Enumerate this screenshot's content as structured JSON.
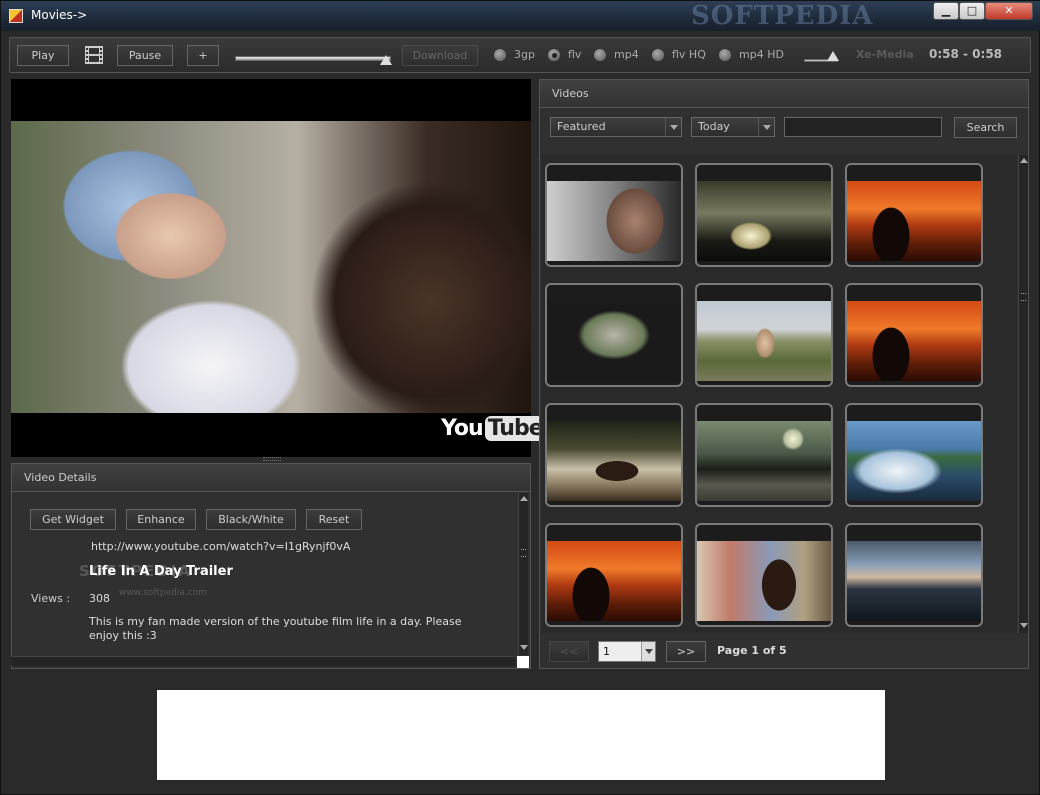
{
  "window": {
    "title": "Movies->",
    "watermark": "SOFTPEDIA",
    "controls": {
      "minimize": "▁",
      "maximize": "□",
      "close": "✕"
    }
  },
  "toolbar": {
    "play": "Play",
    "pause": "Pause",
    "add": "+",
    "download": "Download",
    "progress": 0.97,
    "volume": 0.85,
    "formats": [
      {
        "label": "3gp",
        "selected": false
      },
      {
        "label": "flv",
        "selected": true
      },
      {
        "label": "mp4",
        "selected": false
      },
      {
        "label": "flv HQ",
        "selected": false
      },
      {
        "label": "mp4 HD",
        "selected": false
      }
    ],
    "brand": "Xe-Media",
    "time": "0:58 - 0:58"
  },
  "player": {
    "logo_you": "You",
    "logo_tube": "Tube"
  },
  "details": {
    "header": "Video Details",
    "buttons": {
      "get_widget": "Get Widget",
      "enhance": "Enhance",
      "black_white": "Black/White",
      "reset": "Reset"
    },
    "url": "http://www.youtube.com/watch?v=I1gRynjf0vA",
    "title": "Life In A Day Trailer",
    "watermark": "SOFTPEDIA",
    "watermark_url": "www.softpedia.com",
    "views_label": "Views :",
    "views": "308",
    "description": "This is my fan made version of the youtube film life in a day. Please enjoy this :3"
  },
  "videos": {
    "header": "Videos",
    "category": "Featured",
    "period": "Today",
    "search_value": "",
    "search_button": "Search",
    "prev": "<<",
    "next": ">>",
    "page": "1",
    "page_info": "Page 1 of 5"
  }
}
